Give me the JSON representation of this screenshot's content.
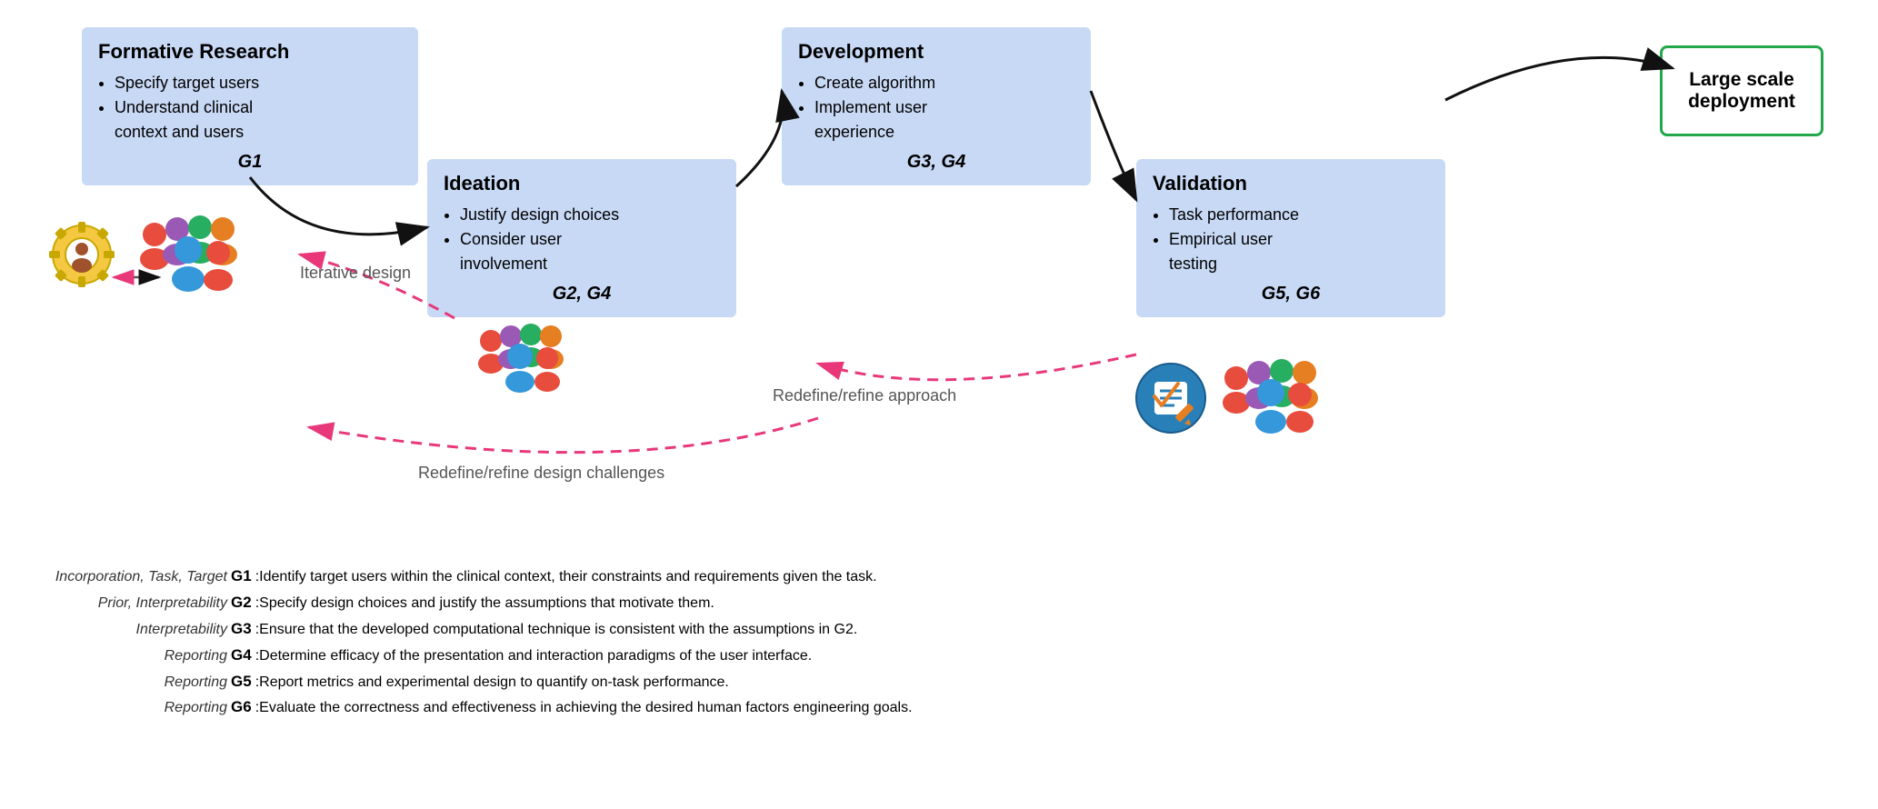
{
  "boxes": {
    "formative": {
      "title": "Formative Research",
      "bullets": [
        "Specify target users",
        "Understand clinical context and users"
      ],
      "goals": "G1"
    },
    "development": {
      "title": "Development",
      "bullets": [
        "Create algorithm",
        "Implement user experience"
      ],
      "goals": "G3, G4"
    },
    "ideation": {
      "title": "Ideation",
      "bullets": [
        "Justify design choices",
        "Consider user involvement"
      ],
      "goals": "G2, G4"
    },
    "validation": {
      "title": "Validation",
      "bullets": [
        "Task performance",
        "Empirical user testing"
      ],
      "goals": "G5, G6"
    },
    "deployment": {
      "title": "Large scale deployment"
    }
  },
  "labels": {
    "iterative_design": "Iterative\ndesign",
    "redefine_approach": "Redefine/refine approach",
    "redefine_challenges": "Redefine/refine design challenges"
  },
  "legend": [
    {
      "italic": "Incorporation, Task, Target",
      "bold": "G1",
      "colon": ":",
      "text": " Identify target users within the clinical context, their constraints and requirements given the task."
    },
    {
      "italic": "Prior, Interpretability",
      "bold": "G2",
      "colon": ":",
      "text": " Specify design choices and justify the assumptions that motivate them."
    },
    {
      "italic": "Interpretability",
      "bold": "G3",
      "colon": ":",
      "text": " Ensure that the developed computational technique is consistent with the assumptions in G2."
    },
    {
      "italic": "Reporting",
      "bold": "G4",
      "colon": ":",
      "text": " Determine efficacy of the presentation and interaction paradigms of the user interface."
    },
    {
      "italic": "Reporting",
      "bold": "G5",
      "colon": ":",
      "text": " Report metrics and experimental design to quantify on-task performance."
    },
    {
      "italic": "Reporting",
      "bold": "G6",
      "colon": ":",
      "text": " Evaluate the correctness and effectiveness in achieving the desired human factors engineering goals."
    }
  ]
}
